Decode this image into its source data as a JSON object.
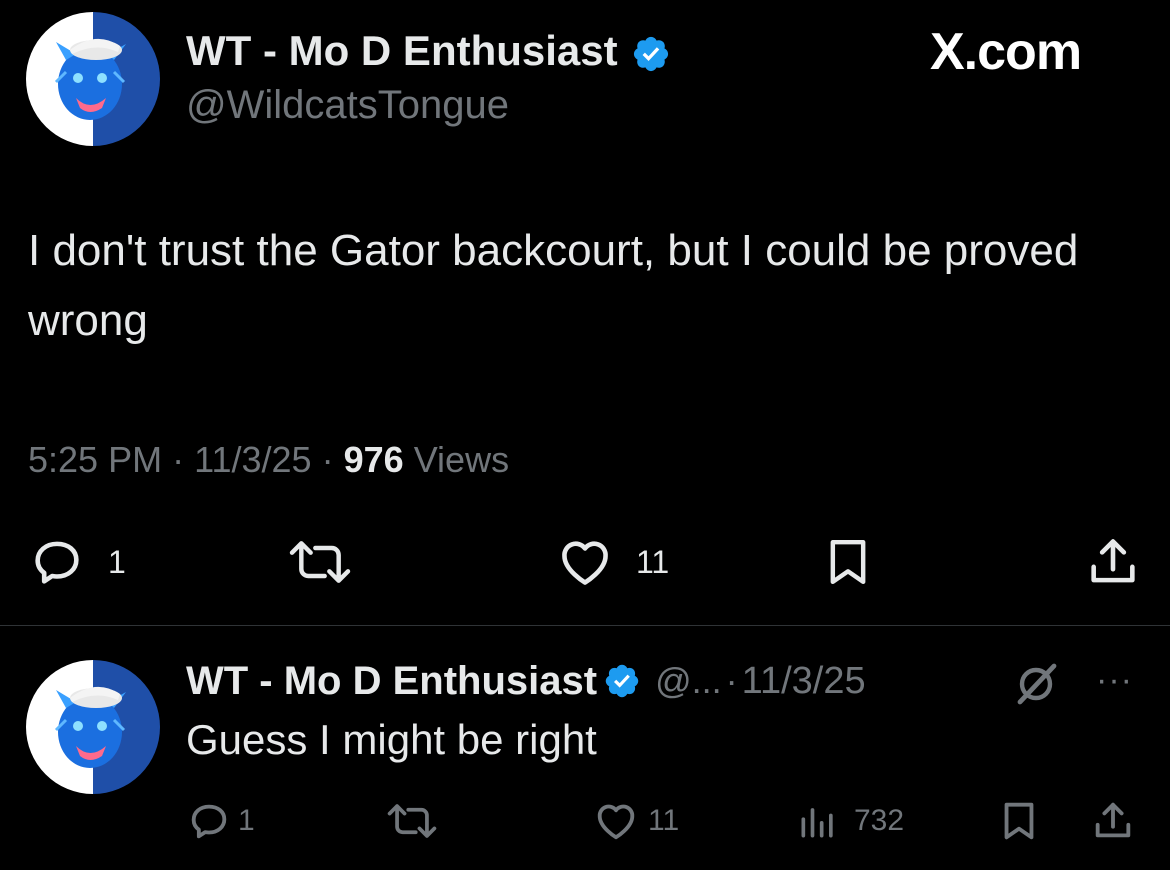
{
  "main_tweet": {
    "author_name": "WT - Mo D Enthusiast",
    "handle": "@WildcatsTongue",
    "brand": "X.com",
    "text": "I don't trust the Gator backcourt, but I could be proved wrong",
    "time": "5:25 PM",
    "date": "11/3/25",
    "views_count": "976",
    "views_label": "Views",
    "separator": "·",
    "actions": {
      "reply_count": "1",
      "repost_count": "",
      "like_count": "11"
    }
  },
  "reply": {
    "author_name": "WT - Mo D Enthusiast",
    "handle_truncated": "@...",
    "separator": "·",
    "date": "11/3/25",
    "more": "···",
    "text": "Guess I might be right",
    "actions": {
      "reply_count": "1",
      "repost_count": "",
      "like_count": "11",
      "views_count": "732"
    }
  },
  "colors": {
    "background": "#000000",
    "text": "#e7e9ea",
    "muted": "#71767b",
    "verified": "#1d9bf0",
    "avatar_blue": "#1f4fa8"
  },
  "icons": [
    "verified-badge-icon",
    "reply-icon",
    "repost-icon",
    "like-icon",
    "bookmark-icon",
    "share-icon",
    "grok-icon",
    "more-icon",
    "views-icon"
  ]
}
